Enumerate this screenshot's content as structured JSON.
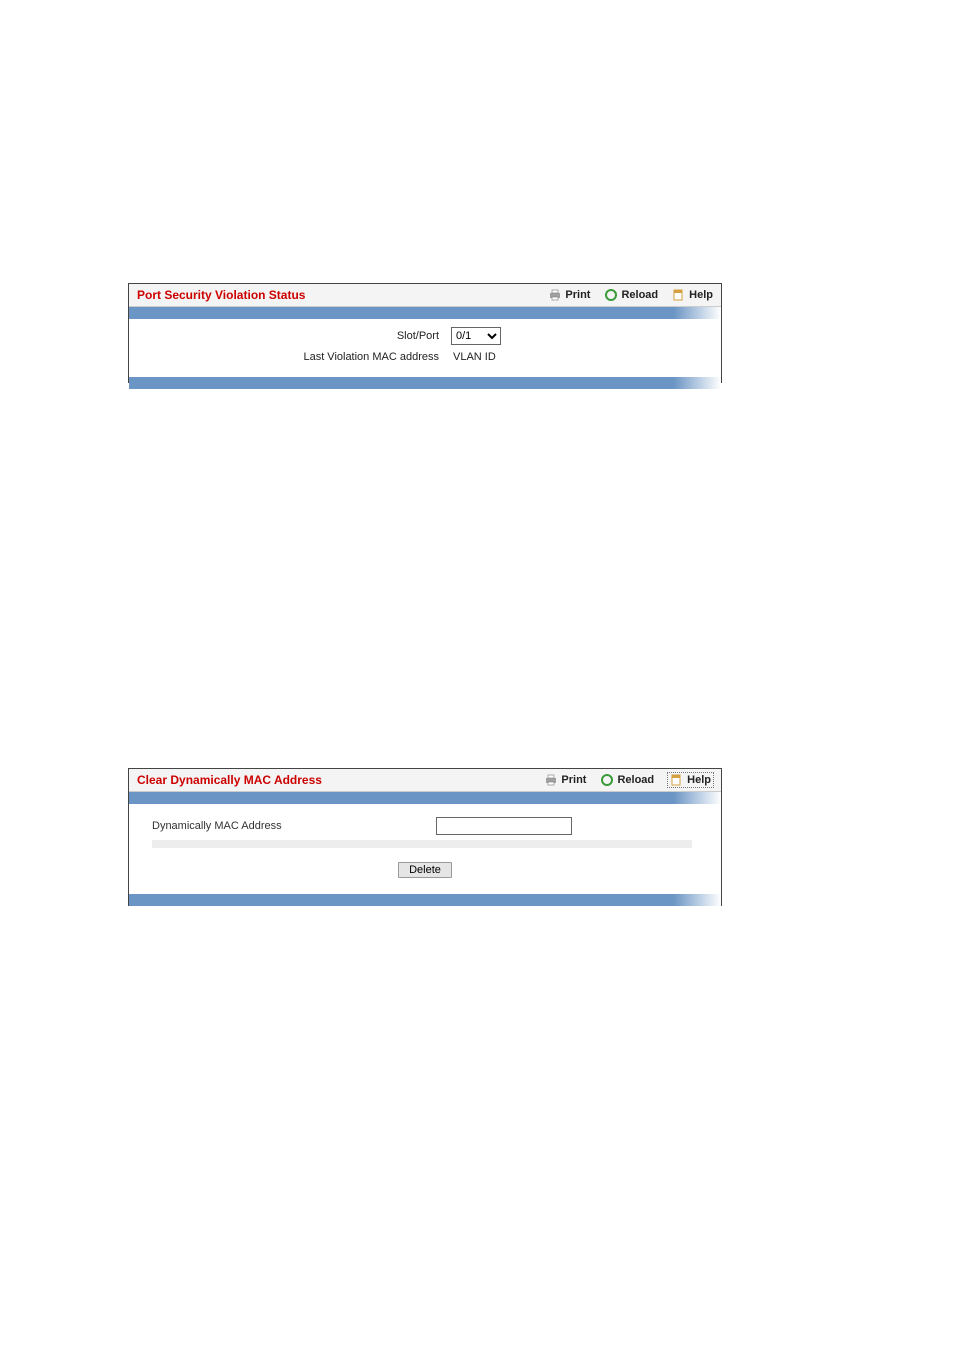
{
  "panel1": {
    "title": "Port Security Violation Status",
    "actions": {
      "print": "Print",
      "reload": "Reload",
      "help": "Help"
    },
    "slot_port_label": "Slot/Port",
    "slot_port_value": "0/1",
    "last_violation_mac_label": "Last Violation MAC address",
    "vlan_id_label": "VLAN ID"
  },
  "panel2": {
    "title": "Clear Dynamically MAC Address",
    "actions": {
      "print": "Print",
      "reload": "Reload",
      "help": "Help"
    },
    "mac_label": "Dynamically MAC Address",
    "mac_value": "",
    "delete_label": "Delete"
  }
}
